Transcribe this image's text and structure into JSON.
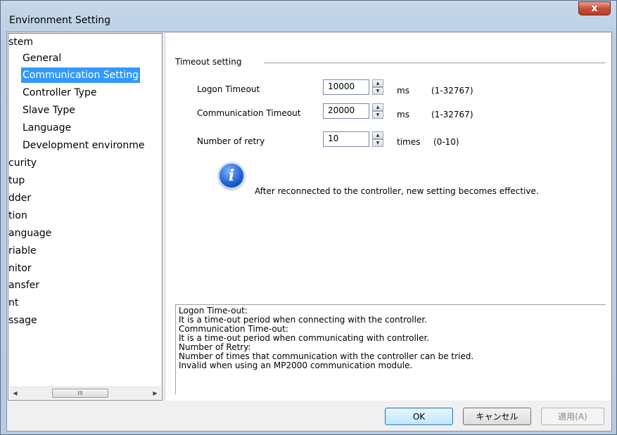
{
  "window": {
    "title": "Environment Setting",
    "close_glyph": "x"
  },
  "tree": {
    "items": [
      "stem",
      "General",
      "Communication Setting",
      "Controller Type",
      "Slave Type",
      "Language",
      "Development environme",
      "curity",
      "tup",
      "dder",
      "tion",
      "anguage",
      "riable",
      "nitor",
      "ansfer",
      "nt",
      "ssage"
    ],
    "selected_index": 2,
    "scrollbar": {
      "left_arrow": "◀",
      "right_arrow": "▶",
      "thumb_grip": "III"
    }
  },
  "timeout": {
    "group_title": "Timeout setting",
    "rows": [
      {
        "label": "Logon Timeout",
        "value": "10000",
        "unit": "ms",
        "range": "(1-32767)"
      },
      {
        "label": "Communication Timeout",
        "value": "20000",
        "unit": "ms",
        "range": "(1-32767)"
      },
      {
        "label": "Number of retry",
        "value": "10",
        "unit": "times",
        "range": "(0-10)"
      }
    ],
    "spin_up": "▲",
    "spin_down": "▼"
  },
  "info": {
    "icon_glyph": "i",
    "text": "After reconnected to the controller, new setting becomes effective."
  },
  "help": {
    "lines": [
      "Logon Time-out:",
      "It is a time-out period when connecting with the controller.",
      "Communication Time-out:",
      "It is a time-out period when communicating with controller.",
      "Number of Retry:",
      "Number of times that communication with the controller can be tried.",
      "Invalid when using an MP2000 communication module."
    ]
  },
  "buttons": {
    "ok": "OK",
    "cancel": "キャンセル",
    "apply": "適用(A)"
  }
}
